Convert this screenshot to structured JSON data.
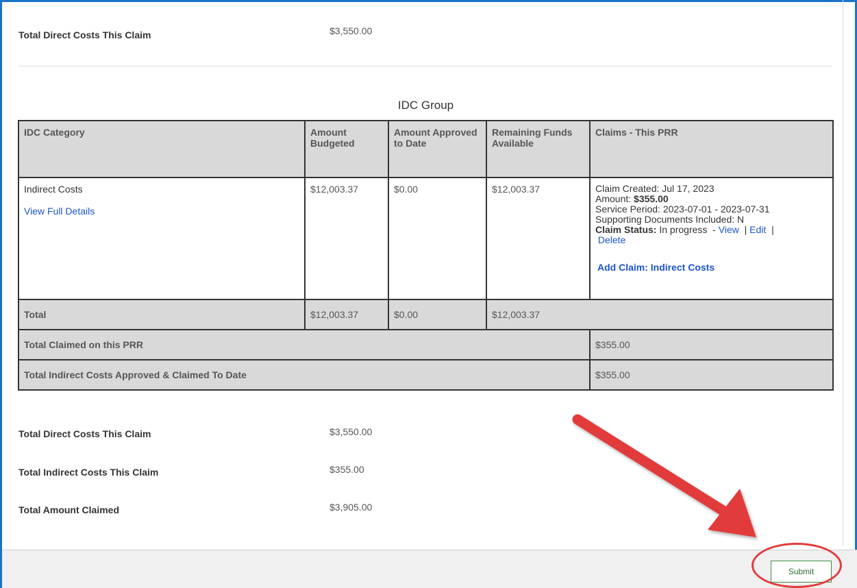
{
  "top_summary": {
    "label": "Total Direct Costs This Claim",
    "value": "$3,550.00"
  },
  "idc_group": {
    "title": "IDC Group",
    "headers": {
      "category": "IDC Category",
      "budgeted": "Amount Budgeted",
      "approved": "Amount Approved to Date",
      "remaining": "Remaining Funds Available",
      "claims": "Claims - This PRR"
    },
    "row": {
      "category": "Indirect Costs",
      "details_link": "View Full Details",
      "budgeted": "$12,003.37",
      "approved": "$0.00",
      "remaining": "$12,003.37",
      "claim_created_label": "Claim Created:",
      "claim_created_value": "Jul 17, 2023",
      "amount_label": "Amount:",
      "amount_value": "$355.00",
      "service_period_label": "Service Period:",
      "service_period_value": "2023-07-01 - 2023-07-31",
      "supporting_docs_label": "Supporting Documents Included:",
      "supporting_docs_value": "N",
      "claim_status_label": "Claim Status:",
      "claim_status_value": "In progress",
      "status_dash": "-",
      "view_link": "View",
      "edit_link": "Edit",
      "delete_link": "Delete",
      "separator": "|",
      "add_claim_link": "Add Claim: Indirect Costs"
    },
    "total_row": {
      "label": "Total",
      "budgeted": "$12,003.37",
      "approved": "$0.00",
      "remaining": "$12,003.37"
    },
    "claimed_prr": {
      "label": "Total Claimed on this PRR",
      "value": "$355.00"
    },
    "approved_claimed": {
      "label": "Total Indirect Costs Approved & Claimed To Date",
      "value": "$355.00"
    }
  },
  "bottom_summary": [
    {
      "label": "Total Direct Costs This Claim",
      "value": "$3,550.00"
    },
    {
      "label": "Total Indirect Costs This Claim",
      "value": "$355.00"
    },
    {
      "label": "Total Amount Claimed",
      "value": "$3,905.00"
    }
  ],
  "footer": {
    "submit_label": "Submit"
  },
  "colors": {
    "link": "#1a55c7",
    "header_bg": "#d9d9d9",
    "annotation": "#e23b3b",
    "submit_border": "#3f8c3f"
  }
}
